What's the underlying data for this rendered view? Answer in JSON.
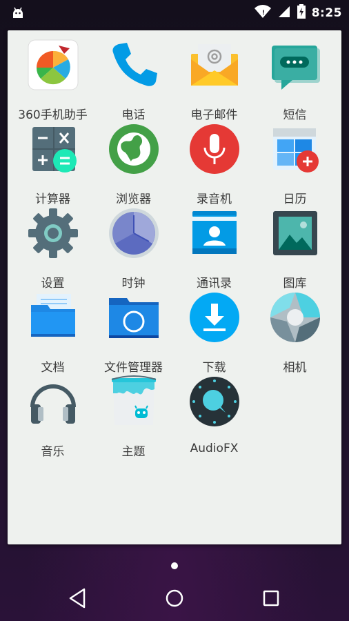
{
  "status_bar": {
    "time": "8:25",
    "notification_icon": "android-icon",
    "wifi_icon": "wifi-icon",
    "cell_icon": "cell-signal-icon",
    "battery_icon": "battery-icon"
  },
  "apps": [
    {
      "label": "360手机助手",
      "icon": "360-assistant-icon"
    },
    {
      "label": "电话",
      "icon": "phone-icon"
    },
    {
      "label": "电子邮件",
      "icon": "email-icon"
    },
    {
      "label": "短信",
      "icon": "sms-icon"
    },
    {
      "label": "计算器",
      "icon": "calculator-icon"
    },
    {
      "label": "浏览器",
      "icon": "browser-icon"
    },
    {
      "label": "录音机",
      "icon": "recorder-icon"
    },
    {
      "label": "日历",
      "icon": "calendar-icon"
    },
    {
      "label": "设置",
      "icon": "settings-icon"
    },
    {
      "label": "时钟",
      "icon": "clock-icon"
    },
    {
      "label": "通讯录",
      "icon": "contacts-icon"
    },
    {
      "label": "图库",
      "icon": "gallery-icon"
    },
    {
      "label": "文档",
      "icon": "documents-icon"
    },
    {
      "label": "文件管理器",
      "icon": "file-manager-icon"
    },
    {
      "label": "下载",
      "icon": "download-icon"
    },
    {
      "label": "相机",
      "icon": "camera-icon"
    },
    {
      "label": "音乐",
      "icon": "music-icon"
    },
    {
      "label": "主题",
      "icon": "themes-icon"
    },
    {
      "label": "AudioFX",
      "icon": "audiofx-icon"
    }
  ],
  "pager": {
    "current_page": 1
  },
  "nav_bar": {
    "back": "back-icon",
    "home": "home-icon",
    "recents": "recents-icon"
  }
}
